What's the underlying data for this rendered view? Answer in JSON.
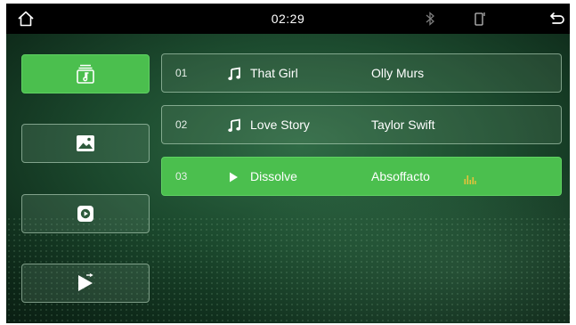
{
  "status_bar": {
    "time": "02:29",
    "icons": [
      "home-icon",
      "bluetooth-icon",
      "phone-icon",
      "back-arrow-icon"
    ]
  },
  "sidebar": {
    "items": [
      {
        "icon": "music-folder-icon",
        "active": true
      },
      {
        "icon": "image-icon",
        "active": false
      },
      {
        "icon": "video-play-icon",
        "active": false
      },
      {
        "icon": "play-next-icon",
        "active": false
      }
    ]
  },
  "playlist": {
    "tracks": [
      {
        "number": "01",
        "title": "That Girl",
        "artist": "Olly Murs",
        "icon": "music-note-icon",
        "playing": false
      },
      {
        "number": "02",
        "title": "Love Story",
        "artist": "Taylor Swift",
        "icon": "music-note-icon",
        "playing": false
      },
      {
        "number": "03",
        "title": "Dissolve",
        "artist": "Absoffacto",
        "icon": "play-icon",
        "playing": true
      }
    ]
  },
  "colors": {
    "accent": "#4bbf4e",
    "equalizer": "#e8c23a",
    "status_bar": "#000000"
  }
}
